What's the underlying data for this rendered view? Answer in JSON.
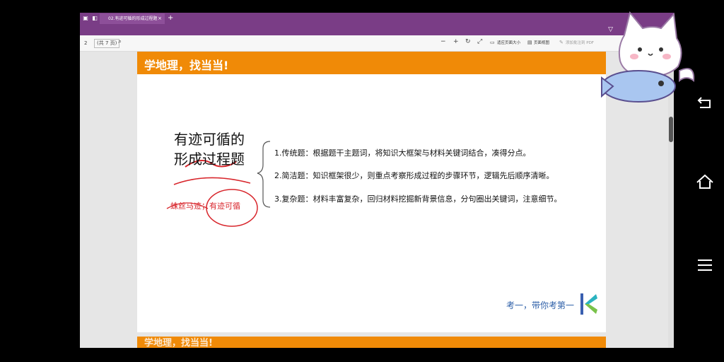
{
  "tab": {
    "title": "02.有迹可循的形成过程题",
    "close": "×",
    "new": "+"
  },
  "toolbar": {
    "page_number": "2",
    "page_total": "(共 7 页)",
    "fit_label": "适应页面大小",
    "view_label": "页面视图",
    "annotate_label": "添加批注到 PDF"
  },
  "slide": {
    "banner": "学地理，找当当!",
    "title_line1": "有迹可循的",
    "title_line2": "形成过程题",
    "handwritten": "蛛丝马迹；有迹可循",
    "items": [
      "1.传统题：根据题干主题词，将知识大框架与材料关键词结合，凑得分点。",
      "2.简洁题：知识框架很少，则重点考察形成过程的步骤环节，逻辑先后顺序清晰。",
      "3.复杂题：材料丰富复杂，回归材料挖掘新背景信息，分句圈出关键词，注意细节。"
    ],
    "footer": "考一，带你考第一"
  },
  "next_page_banner": "学地理，找当当!",
  "colors": {
    "orange": "#f08a07",
    "purple": "#7a3d86",
    "red_ink": "#d8262c",
    "blue": "#2d5fa8"
  }
}
